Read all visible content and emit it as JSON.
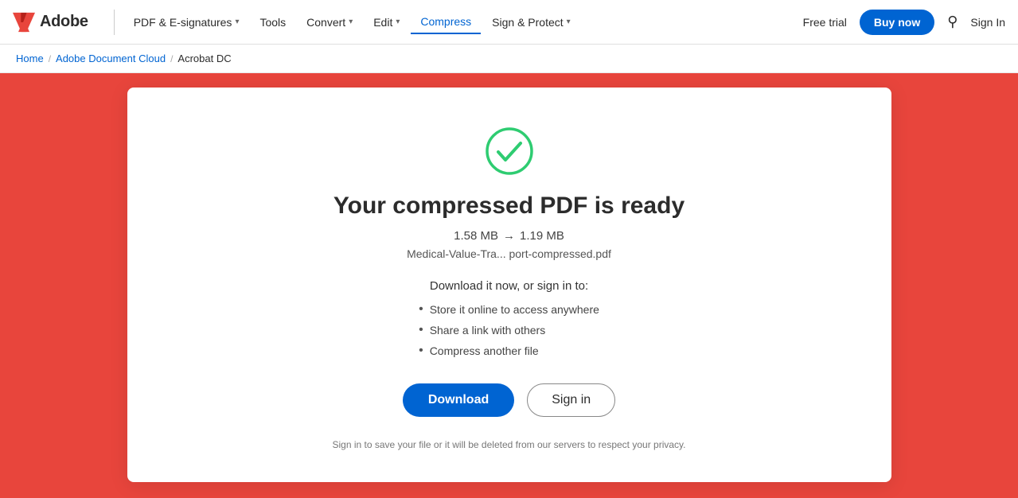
{
  "brand": {
    "logo_text": "Adobe",
    "logo_color": "#e8453c"
  },
  "navbar": {
    "pdf_esig_label": "PDF & E-signatures",
    "tools_label": "Tools",
    "convert_label": "Convert",
    "edit_label": "Edit",
    "compress_label": "Compress",
    "sign_protect_label": "Sign & Protect",
    "free_trial_label": "Free trial",
    "buy_now_label": "Buy now",
    "sign_in_label": "Sign In"
  },
  "breadcrumb": {
    "home": "Home",
    "adobe_doc_cloud": "Adobe Document Cloud",
    "acrobat_dc": "Acrobat DC"
  },
  "card": {
    "title": "Your compressed PDF is ready",
    "size_from": "1.58 MB",
    "arrow": "→",
    "size_to": "1.19 MB",
    "filename": "Medical-Value-Tra... port-compressed.pdf",
    "prompt": "Download it now, or sign in to:",
    "list_items": [
      "Store it online to access anywhere",
      "Share a link with others",
      "Compress another file"
    ],
    "download_label": "Download",
    "signin_label": "Sign in",
    "privacy_note": "Sign in to save your file or it will be deleted from our servers to respect your privacy."
  }
}
